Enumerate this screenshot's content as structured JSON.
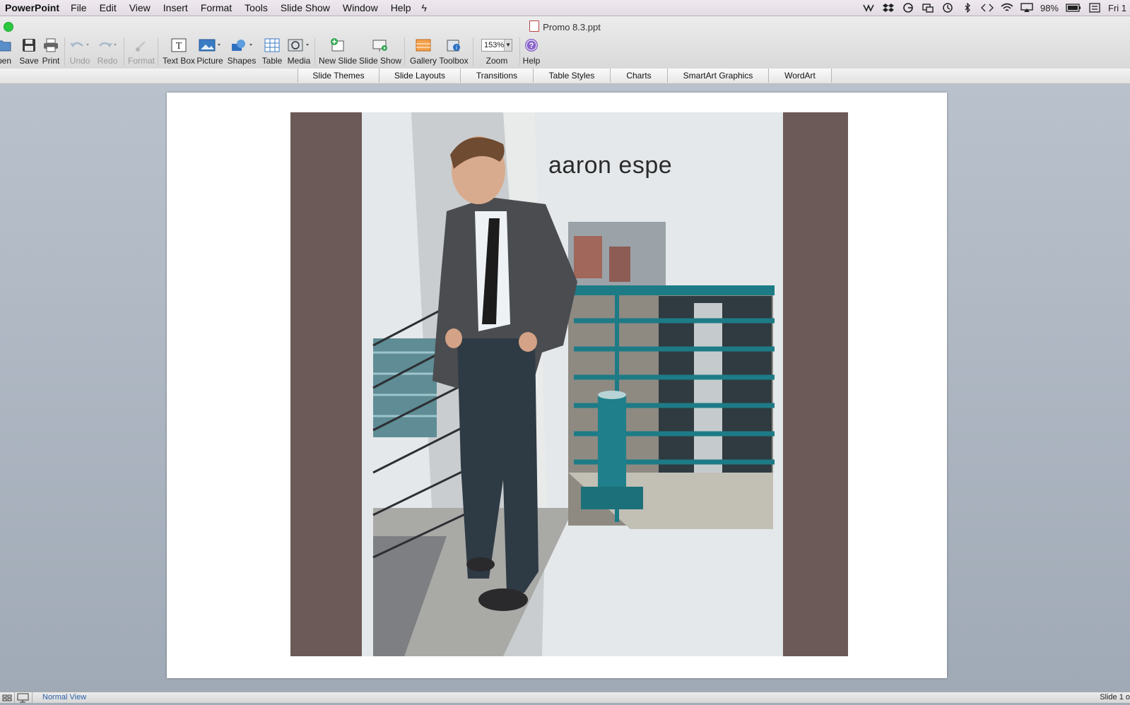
{
  "menubar": {
    "app_name": "PowerPoint",
    "menus": [
      "File",
      "Edit",
      "View",
      "Insert",
      "Format",
      "Tools",
      "Slide Show",
      "Window",
      "Help"
    ],
    "battery": "98%",
    "clock": "Fri 1"
  },
  "window": {
    "title": "Promo 8.3.ppt"
  },
  "toolbar": {
    "open_label": "pen",
    "save_label": "Save",
    "print_label": "Print",
    "undo_label": "Undo",
    "redo_label": "Redo",
    "format_label": "Format",
    "textbox_label": "Text Box",
    "picture_label": "Picture",
    "shapes_label": "Shapes",
    "table_label": "Table",
    "media_label": "Media",
    "newslide_label": "New Slide",
    "slideshow_label": "Slide Show",
    "gallery_label": "Gallery",
    "toolbox_label": "Toolbox",
    "zoom_value": "153%",
    "zoom_label": "Zoom",
    "help_label": "Help"
  },
  "ribbon": {
    "tabs": [
      "Slide Themes",
      "Slide Layouts",
      "Transitions",
      "Table Styles",
      "Charts",
      "SmartArt Graphics",
      "WordArt"
    ]
  },
  "slide": {
    "title_text": "aaron espe",
    "colors": {
      "side_bars": "#6b5a58",
      "photo_background": "#e4e8ea",
      "railing": "#1d7b86"
    }
  },
  "statusbar": {
    "view_label": "Normal View",
    "slide_counter": "Slide 1 o"
  }
}
